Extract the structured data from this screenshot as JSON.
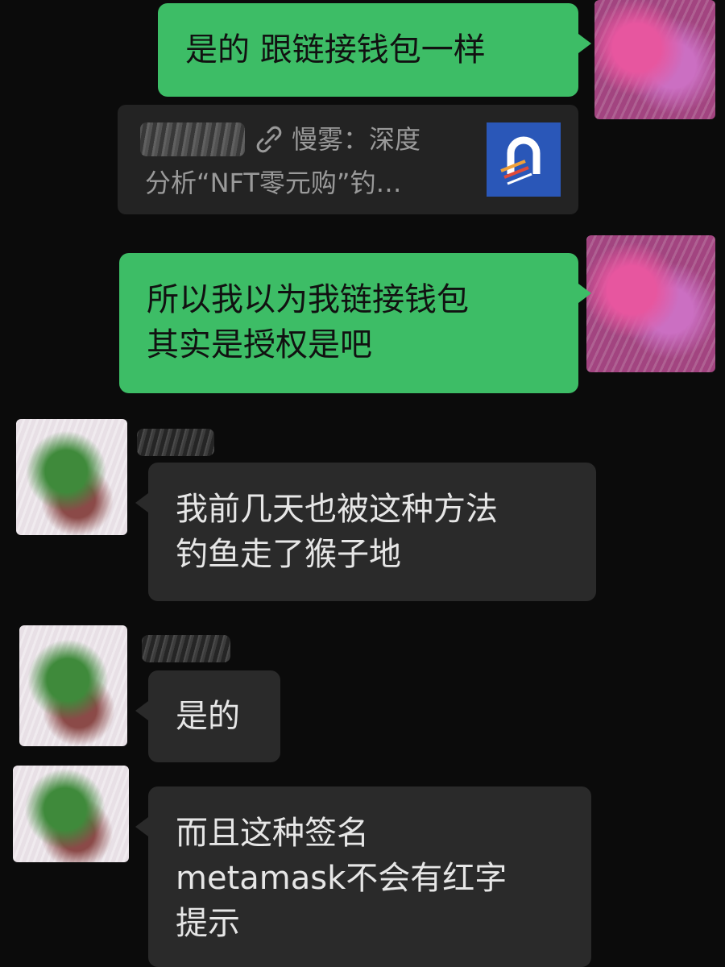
{
  "chat": {
    "messages": [
      {
        "sender": "self",
        "lines": [
          "是的 跟链接钱包一样"
        ]
      },
      {
        "sender": "self",
        "type": "link",
        "title_lines": [
          "慢雾：深度",
          "分析“NFT零元购”钓…"
        ]
      },
      {
        "sender": "self",
        "lines": [
          "所以我以为我链接钱包",
          "其实是授权是吧"
        ]
      },
      {
        "sender": "other",
        "lines": [
          "我前几天也被这种方法",
          "钓鱼走了猴子地"
        ]
      },
      {
        "sender": "other",
        "lines": [
          "是的"
        ]
      },
      {
        "sender": "other",
        "lines": [
          "而且这种签名",
          "metamask不会有红字",
          "提示"
        ]
      }
    ]
  },
  "colors": {
    "background": "#0b0b0b",
    "sent_bubble": "#3dbd66",
    "received_bubble": "#2a2a2a",
    "link_card": "#232323",
    "link_thumb": "#2a57b8"
  },
  "icons": {
    "link": "chain-link-icon"
  }
}
